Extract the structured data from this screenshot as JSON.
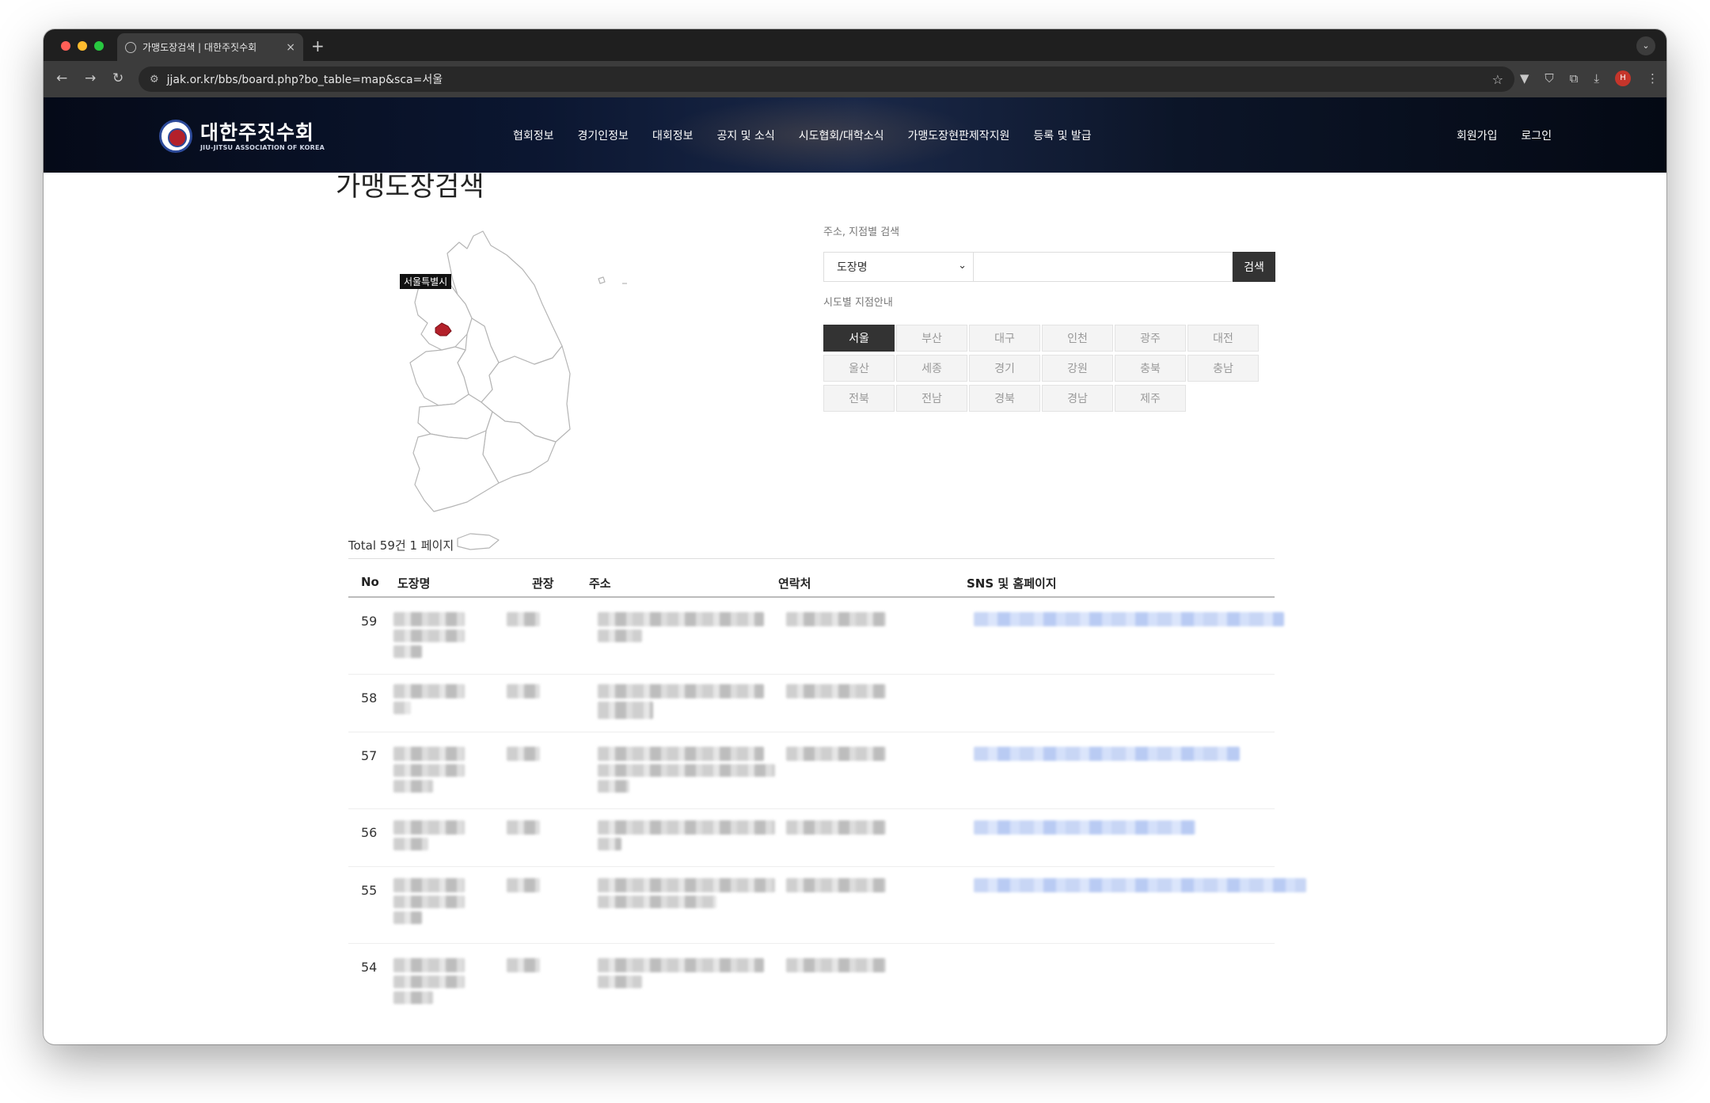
{
  "browser": {
    "tab_title": "가맹도장검색 | 대한주짓수회",
    "new_tab": "+",
    "tab_close": "×",
    "url": "jjak.or.kr/bbs/board.php?bo_table=map&sca=서울",
    "profile_initial": "H",
    "icons": [
      "back-icon",
      "forward-icon",
      "reload-icon",
      "site-settings-icon",
      "bookmark-star-icon",
      "extension-icon",
      "download-icon",
      "menu-icon"
    ]
  },
  "site": {
    "logo_ko": "대한주짓수회",
    "logo_en": "JIU-JITSU ASSOCIATION OF KOREA",
    "nav": [
      "협회정보",
      "경기인정보",
      "대회정보",
      "공지 및 소식",
      "시도협회/대학소식",
      "가맹도장현판제작지원",
      "등록 및 발급"
    ],
    "member": {
      "signup": "회원가입",
      "login": "로그인"
    }
  },
  "page": {
    "title": "가맹도장검색",
    "map_label": "서울특별시",
    "search": {
      "label": "주소, 지점별 검색",
      "select_value": "도장명",
      "input_value": "",
      "button": "검색"
    },
    "region": {
      "label": "시도별 지점안내",
      "items": [
        "서울",
        "부산",
        "대구",
        "인천",
        "광주",
        "대전",
        "울산",
        "세종",
        "경기",
        "강원",
        "충북",
        "충남",
        "전북",
        "전남",
        "경북",
        "경남",
        "제주"
      ],
      "active": "서울"
    },
    "total": "Total 59건 1 페이지",
    "table": {
      "headers": [
        "No",
        "도장명",
        "관장",
        "주소",
        "연락처",
        "SNS 및 홈페이지"
      ],
      "rows": [
        {
          "no": "59"
        },
        {
          "no": "58"
        },
        {
          "no": "57"
        },
        {
          "no": "56"
        },
        {
          "no": "55"
        },
        {
          "no": "54"
        }
      ]
    }
  },
  "colors": {
    "header_bg": "#0b1630",
    "active_region": "#333333",
    "map_highlight": "#b3202a",
    "blurred_link": "#c8d6f5"
  }
}
